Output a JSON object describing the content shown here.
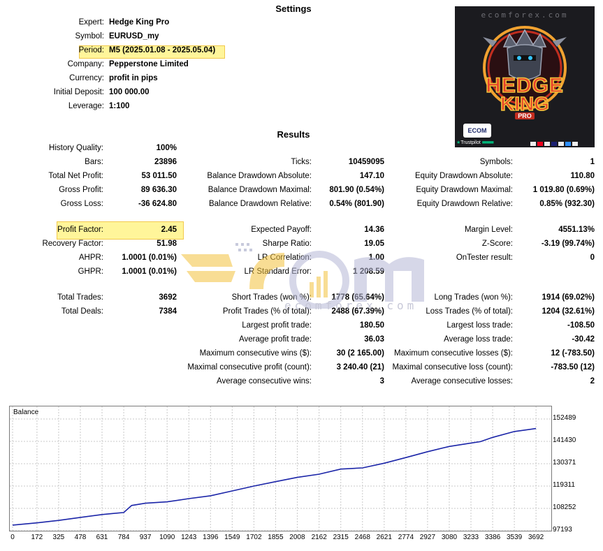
{
  "settings": {
    "heading": "Settings",
    "rows": [
      {
        "label": "Expert:",
        "value": "Hedge King Pro"
      },
      {
        "label": "Symbol:",
        "value": "EURUSD_my"
      },
      {
        "label": "Period:",
        "value": "M5 (2025.01.08 - 2025.05.04)"
      },
      {
        "label": "Company:",
        "value": "Pepperstone Limited"
      },
      {
        "label": "Currency:",
        "value": "profit in pips"
      },
      {
        "label": "Initial Deposit:",
        "value": "100 000.00"
      },
      {
        "label": "Leverage:",
        "value": "1:100"
      }
    ]
  },
  "results": {
    "heading": "Results",
    "col1": [
      {
        "label": "History Quality:",
        "value": "100%"
      },
      {
        "label": "Bars:",
        "value": "23896"
      },
      {
        "label": "Total Net Profit:",
        "value": "53 011.50"
      },
      {
        "label": "Gross Profit:",
        "value": "89 636.30"
      },
      {
        "label": "Gross Loss:",
        "value": "-36 624.80"
      },
      {
        "label": "Profit Factor:",
        "value": "2.45"
      },
      {
        "label": "Recovery Factor:",
        "value": "51.98"
      },
      {
        "label": "AHPR:",
        "value": "1.0001 (0.01%)"
      },
      {
        "label": "GHPR:",
        "value": "1.0001 (0.01%)"
      },
      {
        "label": "Total Trades:",
        "value": "3692"
      },
      {
        "label": "Total Deals:",
        "value": "7384"
      }
    ],
    "col2": [
      {
        "label": "Ticks:",
        "value": "10459095"
      },
      {
        "label": "Balance Drawdown Absolute:",
        "value": "147.10"
      },
      {
        "label": "Balance Drawdown Maximal:",
        "value": "801.90 (0.54%)"
      },
      {
        "label": "Balance Drawdown Relative:",
        "value": "0.54% (801.90)"
      },
      {
        "label": "Expected Payoff:",
        "value": "14.36"
      },
      {
        "label": "Sharpe Ratio:",
        "value": "19.05"
      },
      {
        "label": "LR Correlation:",
        "value": "1.00"
      },
      {
        "label": "LR Standard Error:",
        "value": "1 208.59"
      },
      {
        "label": "Short Trades (won %):",
        "value": "1778 (65.64%)"
      },
      {
        "label": "Profit Trades (% of total):",
        "value": "2488 (67.39%)"
      },
      {
        "label": "Largest profit trade:",
        "value": "180.50"
      },
      {
        "label": "Average profit trade:",
        "value": "36.03"
      },
      {
        "label": "Maximum consecutive wins ($):",
        "value": "30 (2 165.00)"
      },
      {
        "label": "Maximal consecutive profit (count):",
        "value": "3 240.40 (21)"
      },
      {
        "label": "Average consecutive wins:",
        "value": "3"
      }
    ],
    "col3": [
      {
        "label": "Symbols:",
        "value": "1"
      },
      {
        "label": "Equity Drawdown Absolute:",
        "value": "110.80"
      },
      {
        "label": "Equity Drawdown Maximal:",
        "value": "1 019.80 (0.69%)"
      },
      {
        "label": "Equity Drawdown Relative:",
        "value": "0.85% (932.30)"
      },
      {
        "label": "Margin Level:",
        "value": "4551.13%"
      },
      {
        "label": "Z-Score:",
        "value": "-3.19 (99.74%)"
      },
      {
        "label": "OnTester result:",
        "value": "0"
      },
      {
        "label": "Long Trades (won %):",
        "value": "1914 (69.02%)"
      },
      {
        "label": "Loss Trades (% of total):",
        "value": "1204 (32.61%)"
      },
      {
        "label": "Largest loss trade:",
        "value": "-108.50"
      },
      {
        "label": "Average loss trade:",
        "value": "-30.42"
      },
      {
        "label": "Maximum consecutive losses ($):",
        "value": "12 (-783.50)"
      },
      {
        "label": "Maximal consecutive loss (count):",
        "value": "-783.50 (12)"
      },
      {
        "label": "Average consecutive losses:",
        "value": "2"
      }
    ]
  },
  "logo": {
    "site": "ecomforex.com",
    "brand_line1": "HEDGE",
    "brand_line2": "KING",
    "brand_line3": "PRO",
    "badge": "ECOM",
    "trustpilot": "Trustpilot",
    "accent_color": "#e8432b",
    "frame_color": "#f1a230"
  },
  "watermark": {
    "brand": "ECOM",
    "site": "ecomforex.com"
  },
  "chart_data": {
    "type": "line",
    "title": "Balance",
    "series": [
      {
        "name": "",
        "color": "#1b25a8",
        "x": [
          0,
          172,
          325,
          478,
          631,
          700,
          784,
          840,
          937,
          1090,
          1243,
          1396,
          1549,
          1702,
          1855,
          2008,
          2162,
          2315,
          2468,
          2621,
          2774,
          2927,
          3080,
          3233,
          3300,
          3386,
          3539,
          3692
        ],
        "y": [
          100000,
          101100,
          102300,
          103800,
          105200,
          105700,
          106200,
          109700,
          110800,
          111500,
          113100,
          114500,
          116900,
          119300,
          121500,
          123600,
          125200,
          127700,
          128300,
          130600,
          133400,
          136300,
          138900,
          140600,
          141300,
          143400,
          146300,
          147800
        ]
      }
    ],
    "x_ticks": [
      0,
      172,
      325,
      478,
      631,
      784,
      937,
      1090,
      1243,
      1396,
      1549,
      1702,
      1855,
      2008,
      2162,
      2315,
      2468,
      2621,
      2774,
      2927,
      3080,
      3233,
      3386,
      3539,
      3692
    ],
    "y_ticks": [
      152489,
      141430,
      130371,
      119311,
      108252,
      97193
    ],
    "xlim": [
      0,
      3780
    ],
    "ylim": [
      97193,
      152489
    ],
    "grid": true
  }
}
